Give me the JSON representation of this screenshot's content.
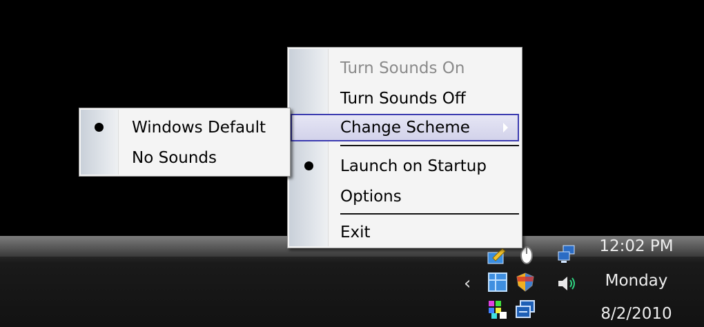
{
  "main_menu": {
    "items": [
      {
        "label": "Turn Sounds On",
        "disabled": true
      },
      {
        "label": "Turn Sounds Off"
      },
      {
        "label": "Change Scheme",
        "highlighted": true,
        "has_submenu": true
      },
      {
        "label": "Launch on Startup",
        "checked": true
      },
      {
        "label": "Options"
      },
      {
        "label": "Exit"
      }
    ]
  },
  "sub_menu": {
    "items": [
      {
        "label": "Windows Default",
        "checked": true
      },
      {
        "label": "No Sounds"
      }
    ]
  },
  "tray": {
    "show_hidden_glyph": "‹",
    "icons": [
      "pencil-icon",
      "mouse-icon",
      "network-icon",
      "window-icon",
      "shield-icon",
      "volume-icon",
      "flower-icon",
      "windows-overlap-icon"
    ]
  },
  "clock": {
    "time": "12:02 PM",
    "day": "Monday",
    "date": "8/2/2010"
  },
  "colors": {
    "highlight_border": "#3b3bb0",
    "menu_bg": "#f4f4f4"
  }
}
